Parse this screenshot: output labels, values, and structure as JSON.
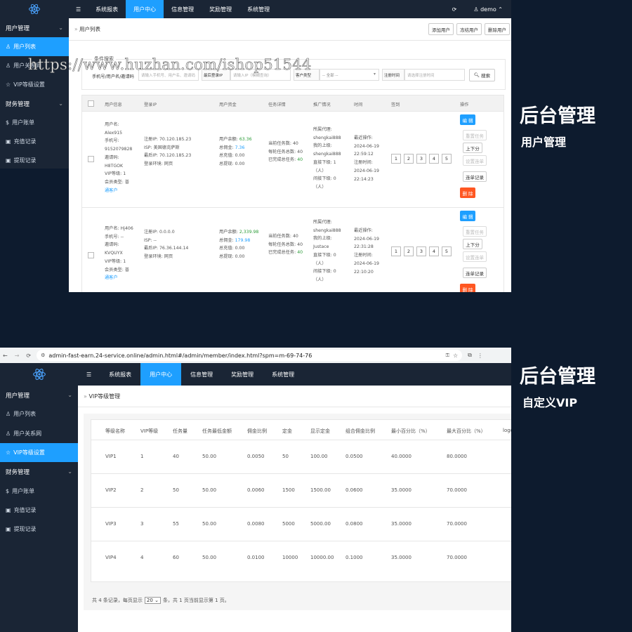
{
  "watermark": "https://www.huzhan.com/ishop51544",
  "panel1": {
    "logo_icon": "react-atom-icon",
    "hamburger": "☰",
    "nav": [
      "系统报表",
      "用户中心",
      "信息管理",
      "奖励管理",
      "系统管理"
    ],
    "user": "demo",
    "sidebar": [
      {
        "label": "用户管理",
        "type": "group"
      },
      {
        "label": "用户列表",
        "type": "item",
        "active": true,
        "icon": "person-icon"
      },
      {
        "label": "用户关系网",
        "type": "item",
        "icon": "person-icon"
      },
      {
        "label": "VIP等级设置",
        "type": "item",
        "icon": "star-icon"
      },
      {
        "label": "财务管理",
        "type": "group"
      },
      {
        "label": "用户账单",
        "type": "item",
        "icon": "dollar-icon"
      },
      {
        "label": "充值记录",
        "type": "item",
        "icon": "wallet-icon"
      },
      {
        "label": "提现记录",
        "type": "item",
        "icon": "wallet-icon"
      }
    ],
    "breadcrumb": "用户列表",
    "actions": [
      "添加用户",
      "冻结用户",
      "删除用户"
    ],
    "filter": {
      "legend": "条件搜索",
      "label1": "手机号/用户名/邀请码",
      "ph1": "请输入手机号、用户名、邀请码",
      "label2": "最后登录IP",
      "ph2": "请输入IP（模糊查询）",
      "label3": "客户类型",
      "select3": "-- 全部 --",
      "label4": "注册时间",
      "ph4": "请选择注册时间",
      "search": "搜索"
    },
    "columns": [
      "用户信息",
      "登录IP",
      "用户资金",
      "任务详情",
      "推广情况",
      "时间",
      "签到",
      "操作"
    ],
    "rows": [
      {
        "info": [
          "用户名:",
          "Alex915",
          "手机号:",
          "9152079828",
          "邀请码:",
          "H8TGOK",
          "VIP等级: 1",
          "会员类型: 普",
          "通客户"
        ],
        "ip": [
          "注册IP: 70.120.185.23",
          "ISP: 美国德克萨斯",
          "最后IP: 70.120.185.23",
          "登录环境: 网页"
        ],
        "balance_label": "用户余额:",
        "balance": "63.36",
        "commission_label": "总佣金:",
        "commission": "7.36",
        "recharge": "总充值: 0.00",
        "withdraw": "总提现: 0.00",
        "task": [
          "当前任务数: 40",
          "每轮任务总数: 40"
        ],
        "task_done_label": "已完成总任务:",
        "task_done": "40",
        "promo": [
          "所属代理:",
          "shengkai888",
          "我的上级:",
          "shengkai888",
          "直接下级: 1",
          "（人）",
          "间接下级: 0",
          "（人）"
        ],
        "time": [
          "最近操作:",
          "2024-06-19",
          "22:59:12",
          "注册时间:",
          "2024-06-19",
          "22:14:23"
        ],
        "signin": [
          "1",
          "2",
          "3",
          "4",
          "5"
        ],
        "ops": [
          "编 辑",
          "重置任务",
          "上下分",
          "设置连单",
          "连单记录",
          "删 除"
        ]
      },
      {
        "info": [
          "用户名: Hj406",
          "手机号: --",
          "邀请码:",
          "KVQUYX",
          "VIP等级: 1",
          "会员类型: 普",
          "通客户"
        ],
        "ip": [
          "注册IP: 0.0.0.0",
          "ISP: --",
          "最后IP: 76.36.144.14",
          "登录环境: 网页"
        ],
        "balance_label": "用户余额:",
        "balance": "2,339.98",
        "commission_label": "总佣金:",
        "commission": "179.98",
        "recharge": "总充值: 0.00",
        "withdraw": "总提现: 0.00",
        "task": [
          "当前任务数: 40",
          "每轮任务总数: 40"
        ],
        "task_done_label": "已完成总任务:",
        "task_done": "40",
        "promo": [
          "所属代理:",
          "shengkai888",
          "我的上级:",
          "Justace",
          "直接下级: 0",
          "（人）",
          "间接下级: 0",
          "（人）"
        ],
        "time": [
          "最近操作:",
          "2024-06-19",
          "22:31:28",
          "注册时间:",
          "2024-06-19",
          "22:10:20"
        ],
        "signin": [
          "1",
          "2",
          "3",
          "4",
          "5"
        ],
        "ops": [
          "编 辑",
          "重置任务",
          "上下分",
          "设置连单",
          "连单记录",
          "删 除"
        ]
      }
    ]
  },
  "title1": {
    "big": "后台管理",
    "sub": "用户管理"
  },
  "title2": {
    "big": "后台管理",
    "sub": "自定义VIP"
  },
  "browser": {
    "url": "admin-fast-earn.24-service.online/admin.html#/admin/member/index.html?spm=m-69-74-76"
  },
  "panel2": {
    "nav": [
      "系统报表",
      "用户中心",
      "信息管理",
      "奖励管理",
      "系统管理"
    ],
    "sidebar": [
      {
        "label": "用户管理",
        "type": "group"
      },
      {
        "label": "用户列表",
        "type": "item",
        "icon": "person-icon"
      },
      {
        "label": "用户关系网",
        "type": "item",
        "icon": "person-icon"
      },
      {
        "label": "VIP等级设置",
        "type": "item",
        "active": true,
        "icon": "star-icon"
      },
      {
        "label": "财务管理",
        "type": "group"
      },
      {
        "label": "用户账单",
        "type": "item",
        "icon": "dollar-icon"
      },
      {
        "label": "充值记录",
        "type": "item",
        "icon": "wallet-icon"
      },
      {
        "label": "提现记录",
        "type": "item",
        "icon": "wallet-icon"
      }
    ],
    "breadcrumb": "VIP等级管理",
    "columns": [
      "等级名称",
      "VIP等级",
      "任务量",
      "任务最低金额",
      "佣金比例",
      "定金",
      "显示定金",
      "组合佣金比例",
      "最小百分比（%）",
      "最大百分比（%）",
      "logo"
    ],
    "rows": [
      [
        "VIP1",
        "1",
        "40",
        "50.00",
        "0.0050",
        "50",
        "100.00",
        "0.0500",
        "40.0000",
        "80.0000",
        ""
      ],
      [
        "VIP2",
        "2",
        "50",
        "50.00",
        "0.0060",
        "1500",
        "1500.00",
        "0.0600",
        "35.0000",
        "70.0000",
        ""
      ],
      [
        "VIP3",
        "3",
        "55",
        "50.00",
        "0.0080",
        "5000",
        "5000.00",
        "0.0800",
        "35.0000",
        "70.0000",
        ""
      ],
      [
        "VIP4",
        "4",
        "60",
        "50.00",
        "0.0100",
        "10000",
        "10000.00",
        "0.1000",
        "35.0000",
        "70.0000",
        ""
      ]
    ],
    "pager": {
      "pre": "共 4 条记录，每页显示",
      "size": "20",
      "post": "条，共 1 页当前显示第 1 页。"
    }
  }
}
